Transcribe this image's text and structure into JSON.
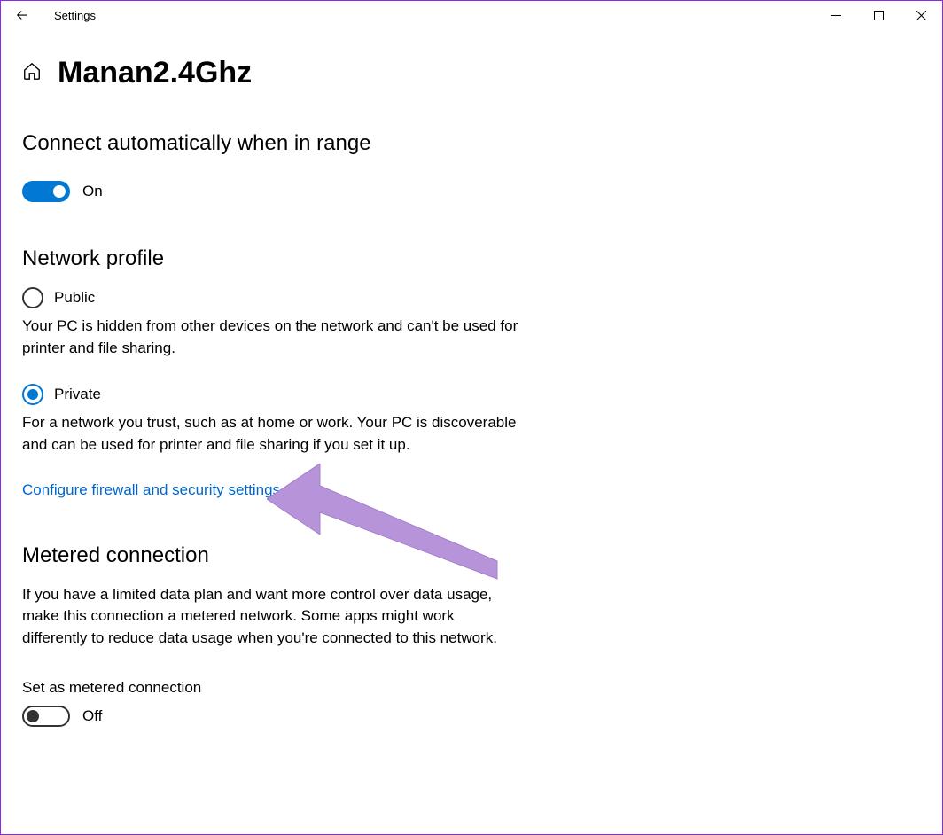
{
  "app_title": "Settings",
  "page_title": "Manan2.4Ghz",
  "connect_section": {
    "title": "Connect automatically when in range",
    "toggle_state": "on",
    "toggle_label": "On"
  },
  "profile_section": {
    "title": "Network profile",
    "public": {
      "label": "Public",
      "desc": "Your PC is hidden from other devices on the network and can't be used for printer and file sharing."
    },
    "private": {
      "label": "Private",
      "desc": "For a network you trust, such as at home or work. Your PC is discoverable and can be used for printer and file sharing if you set it up."
    },
    "firewall_link": "Configure firewall and security settings"
  },
  "metered_section": {
    "title": "Metered connection",
    "desc": "If you have a limited data plan and want more control over data usage, make this connection a metered network. Some apps might work differently to reduce data usage when you're connected to this network.",
    "sublabel": "Set as metered connection",
    "toggle_state": "off",
    "toggle_label": "Off"
  }
}
